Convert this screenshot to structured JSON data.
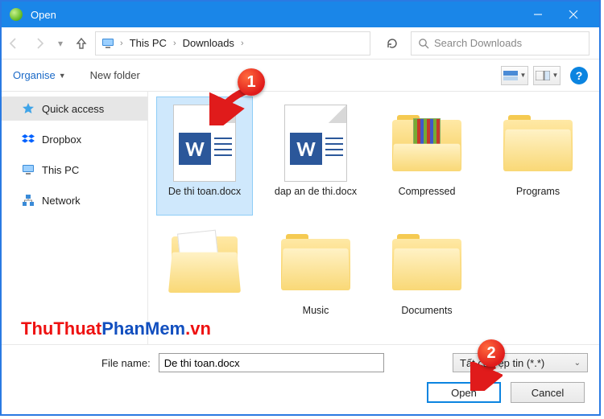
{
  "window": {
    "title": "Open"
  },
  "nav": {
    "breadcrumb": {
      "root": "This PC",
      "folder": "Downloads"
    },
    "search_placeholder": "Search Downloads"
  },
  "toolbar": {
    "organise": "Organise",
    "new_folder": "New folder",
    "help": "?"
  },
  "sidebar": {
    "items": [
      {
        "label": "Quick access",
        "icon": "star-icon",
        "selected": true
      },
      {
        "label": "Dropbox",
        "icon": "dropbox-icon",
        "selected": false
      },
      {
        "label": "This PC",
        "icon": "pc-icon",
        "selected": false
      },
      {
        "label": "Network",
        "icon": "network-icon",
        "selected": false
      }
    ]
  },
  "files": [
    {
      "label": "De thi toan.docx",
      "kind": "word",
      "selected": true
    },
    {
      "label": "dap an de thi.docx",
      "kind": "word",
      "selected": false
    },
    {
      "label": "Compressed",
      "kind": "rarfolder",
      "selected": false
    },
    {
      "label": "Programs",
      "kind": "folder",
      "selected": false
    },
    {
      "label": "",
      "kind": "openfolder",
      "selected": false
    },
    {
      "label": "Music",
      "kind": "folder",
      "selected": false
    },
    {
      "label": "Documents",
      "kind": "folder",
      "selected": false
    }
  ],
  "footer": {
    "file_name_label": "File name:",
    "file_name_value": "De thi toan.docx",
    "filetype_label": "Tất cả Tệp tin (*.*)",
    "open": "Open",
    "cancel": "Cancel"
  },
  "annotations": {
    "badge1": "1",
    "badge2": "2"
  },
  "watermark": {
    "part1": "ThuThuat",
    "part2": "PhanMem",
    "part3": ".vn"
  }
}
